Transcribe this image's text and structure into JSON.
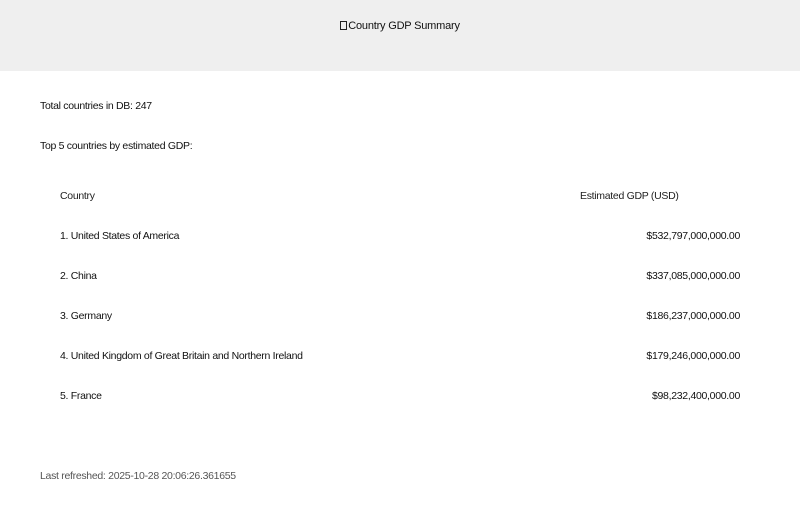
{
  "header": {
    "title": "Country GDP Summary",
    "icon": "document-icon"
  },
  "summary": {
    "total_label": "Total countries in DB: 247",
    "top_label": "Top 5 countries by estimated GDP:"
  },
  "table": {
    "columns": [
      "Country",
      "Estimated GDP (USD)"
    ],
    "rows": [
      {
        "country": "1. United States of America",
        "gdp": "$532,797,000,000.00"
      },
      {
        "country": "2. China",
        "gdp": "$337,085,000,000.00"
      },
      {
        "country": "3. Germany",
        "gdp": "$186,237,000,000.00"
      },
      {
        "country": "4. United Kingdom of Great Britain and Northern Ireland",
        "gdp": "$179,246,000,000.00"
      },
      {
        "country": "5. France",
        "gdp": "$98,232,400,000.00"
      }
    ]
  },
  "footer": {
    "refreshed": "Last refreshed: 2025-10-28 20:06:26.361655"
  }
}
